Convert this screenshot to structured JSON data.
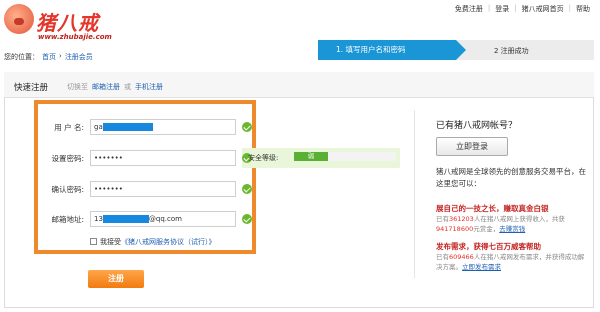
{
  "logo": {
    "text": "猪八戒",
    "url": "www.zhubajie.com"
  },
  "toplinks": [
    "免费注册",
    "登录",
    "猪八戒网首页",
    "帮助"
  ],
  "breadcrumb": {
    "prefix": "您的位置：",
    "home": "首页",
    "sep": "›",
    "current": "注册会员"
  },
  "steps": {
    "step1": "1. 填写用户名和密码",
    "step2": "2 注册成功"
  },
  "panel": {
    "title": "快速注册",
    "switch_prefix": "切换至",
    "email_reg": "邮箱注册",
    "or": "或",
    "phone_reg": "手机注册"
  },
  "form": {
    "username_label": "用 户 名:",
    "username_value": "ga",
    "password_label": "设置密码:",
    "password_value": "•••••••",
    "confirm_label": "确认密码:",
    "confirm_value": "•••••••",
    "email_label": "邮箱地址:",
    "email_prefix": "13",
    "email_suffix": "@qq.com",
    "strength_label": "安全等级:",
    "strength_level": "弱",
    "agree_text": "我接受",
    "agree_link": "《猪八戒网服务协议（试行）》",
    "submit": "注册"
  },
  "right": {
    "title": "已有猪八戒网帐号？",
    "login_button": "立即登录",
    "intro": "猪八戒网是全球领先的创意服务交易平台，在这里您可以：",
    "h1": "展自己的一技之长，赚取真金白银",
    "p1_a": "已有",
    "p1_num1": "361203",
    "p1_b": "人在猪八戒网上获得收入，共获",
    "p1_num2": "941718600",
    "p1_c": "元赏金，",
    "p1_link": "去赚赏钱",
    "h2": "发布需求，获得七百万威客帮助",
    "p2_a": "已有",
    "p2_num": "609466",
    "p2_b": "人在猪八戒网发布需求，并获得成功解决方案。",
    "p2_link": "立即发布需求"
  },
  "colors": {
    "accent_blue": "#1a95d6",
    "highlight_orange": "#ef8a2c",
    "check_green": "#6ab82c",
    "brand_red": "#e4362a"
  }
}
